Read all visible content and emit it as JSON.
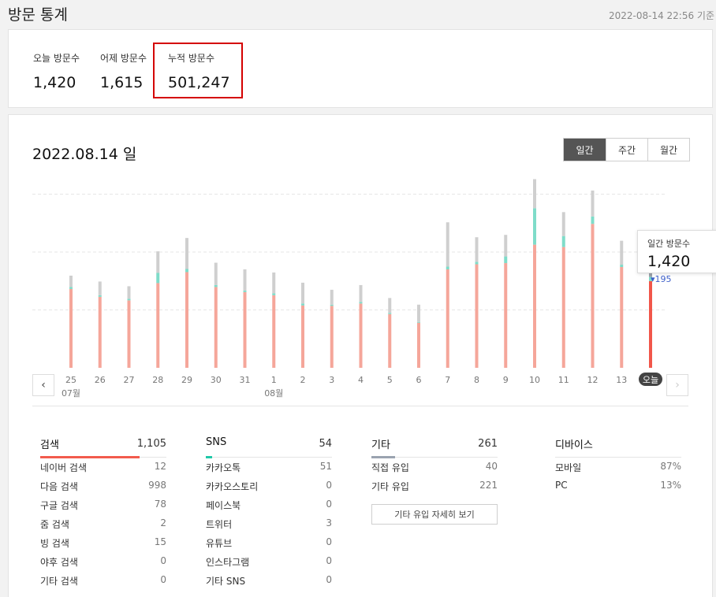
{
  "header": {
    "title": "방문 통계",
    "updated": "2022-08-14 22:56 기준"
  },
  "summary": {
    "today": {
      "label": "오늘 방문수",
      "value": "1,420"
    },
    "yesterday": {
      "label": "어제 방문수",
      "value": "1,615"
    },
    "total": {
      "label": "누적 방문수",
      "value": "501,247"
    }
  },
  "chart_header": {
    "date": "2022.08.14 일",
    "tabs": [
      "일간",
      "주간",
      "월간"
    ],
    "active_tab": "일간"
  },
  "tooltip": {
    "label": "일간 방문수",
    "value": "1,420",
    "delta": "195"
  },
  "colors": {
    "search": "#f5a69a",
    "sns": "#7fdcc9",
    "other": "#cfcfcf",
    "today": "#f1564a",
    "today_other": "#9aa1aa",
    "search_accent": "#f25b4d",
    "sns_accent": "#20c8a8",
    "other_accent": "#9aa3b0"
  },
  "chart_data": {
    "type": "bar",
    "stacked": true,
    "x": [
      "25",
      "26",
      "27",
      "28",
      "29",
      "30",
      "31",
      "1",
      "2",
      "3",
      "4",
      "5",
      "6",
      "7",
      "8",
      "9",
      "10",
      "11",
      "12",
      "13",
      "오늘"
    ],
    "month_labels": [
      {
        "at": "25",
        "text": "07월"
      },
      {
        "at": "1",
        "text": "08월"
      }
    ],
    "series": [
      {
        "key": "search",
        "values": [
          1005,
          905,
          860,
          1080,
          1220,
          1030,
          965,
          925,
          795,
          790,
          820,
          685,
          575,
          1255,
          1320,
          1335,
          1570,
          1540,
          1835,
          1285,
          1105
        ]
      },
      {
        "key": "sns",
        "values": [
          25,
          20,
          20,
          130,
          40,
          25,
          20,
          25,
          25,
          15,
          20,
          15,
          10,
          35,
          30,
          85,
          465,
          140,
          95,
          30,
          54
        ]
      },
      {
        "key": "other",
        "values": [
          145,
          175,
          160,
          275,
          395,
          285,
          270,
          265,
          265,
          190,
          215,
          190,
          220,
          565,
          315,
          275,
          370,
          305,
          330,
          305,
          261
        ]
      }
    ],
    "ylim": [
      0,
      2460
    ],
    "grid": true
  },
  "breakdown": {
    "search": {
      "title": "검색",
      "total": "1,105",
      "rows": [
        {
          "label": "네이버 검색",
          "value": "12"
        },
        {
          "label": "다음 검색",
          "value": "998"
        },
        {
          "label": "구글 검색",
          "value": "78"
        },
        {
          "label": "줌 검색",
          "value": "2"
        },
        {
          "label": "빙 검색",
          "value": "15"
        },
        {
          "label": "야후 검색",
          "value": "0"
        },
        {
          "label": "기타 검색",
          "value": "0"
        }
      ]
    },
    "sns": {
      "title": "SNS",
      "total": "54",
      "rows": [
        {
          "label": "카카오톡",
          "value": "51"
        },
        {
          "label": "카카오스토리",
          "value": "0"
        },
        {
          "label": "페이스북",
          "value": "0"
        },
        {
          "label": "트위터",
          "value": "3"
        },
        {
          "label": "유튜브",
          "value": "0"
        },
        {
          "label": "인스타그램",
          "value": "0"
        },
        {
          "label": "기타 SNS",
          "value": "0"
        }
      ]
    },
    "other": {
      "title": "기타",
      "total": "261",
      "rows": [
        {
          "label": "직접 유입",
          "value": "40"
        },
        {
          "label": "기타 유입",
          "value": "221"
        }
      ],
      "more_button": "기타 유입 자세히 보기"
    },
    "device": {
      "title": "디바이스",
      "rows": [
        {
          "label": "모바일",
          "value": "87%"
        },
        {
          "label": "PC",
          "value": "13%"
        }
      ]
    }
  }
}
